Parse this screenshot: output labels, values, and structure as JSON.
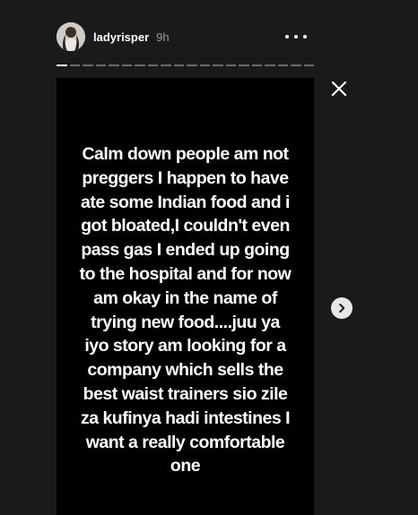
{
  "header": {
    "username": "ladyrisper",
    "time_ago": "9h"
  },
  "progress": {
    "segments": 20,
    "current_index": 1
  },
  "story": {
    "text_lines": [
      "Calm down people am not",
      "preggers I happen to have",
      "ate some Indian food and i",
      "got bloated,I couldn't even",
      "pass gas I ended up going",
      "to the hospital and for now",
      "am okay in the name of",
      "trying new food....juu ya",
      "iyo story am looking for a",
      "company which sells the",
      "best waist trainers sio zile",
      "za kufinya hadi intestines I",
      "want a really comfortable",
      "one"
    ]
  },
  "icons": {
    "more": "more-icon",
    "close": "close-icon",
    "next": "chevron-right-icon"
  }
}
